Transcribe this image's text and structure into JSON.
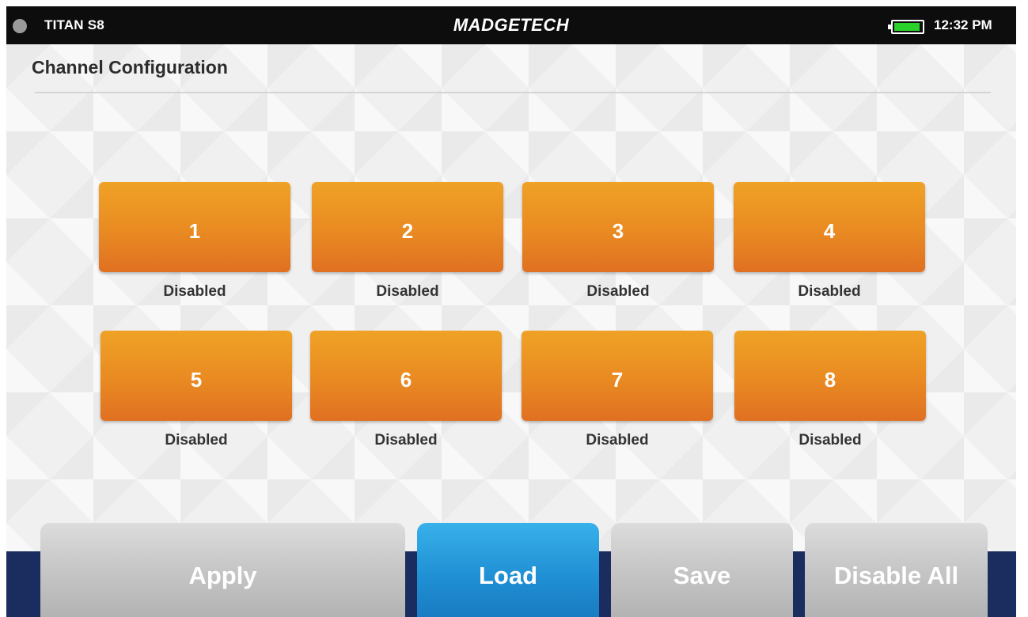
{
  "status_bar": {
    "device_name": "TITAN S8",
    "brand": "MADGETECH",
    "time": "12:32 PM",
    "battery_level": 0.95,
    "indicator_color": "#9a9a9a"
  },
  "page": {
    "title": "Channel Configuration"
  },
  "channels": [
    {
      "number": "1",
      "status": "Disabled"
    },
    {
      "number": "2",
      "status": "Disabled"
    },
    {
      "number": "3",
      "status": "Disabled"
    },
    {
      "number": "4",
      "status": "Disabled"
    },
    {
      "number": "5",
      "status": "Disabled"
    },
    {
      "number": "6",
      "status": "Disabled"
    },
    {
      "number": "7",
      "status": "Disabled"
    },
    {
      "number": "8",
      "status": "Disabled"
    }
  ],
  "actions": {
    "apply": "Apply",
    "load": "Load",
    "save": "Save",
    "disable_all": "Disable All"
  },
  "colors": {
    "channel_button": "#e98a22",
    "load_button": "#1f8ed3",
    "bottom_band": "#1b2c5e"
  }
}
